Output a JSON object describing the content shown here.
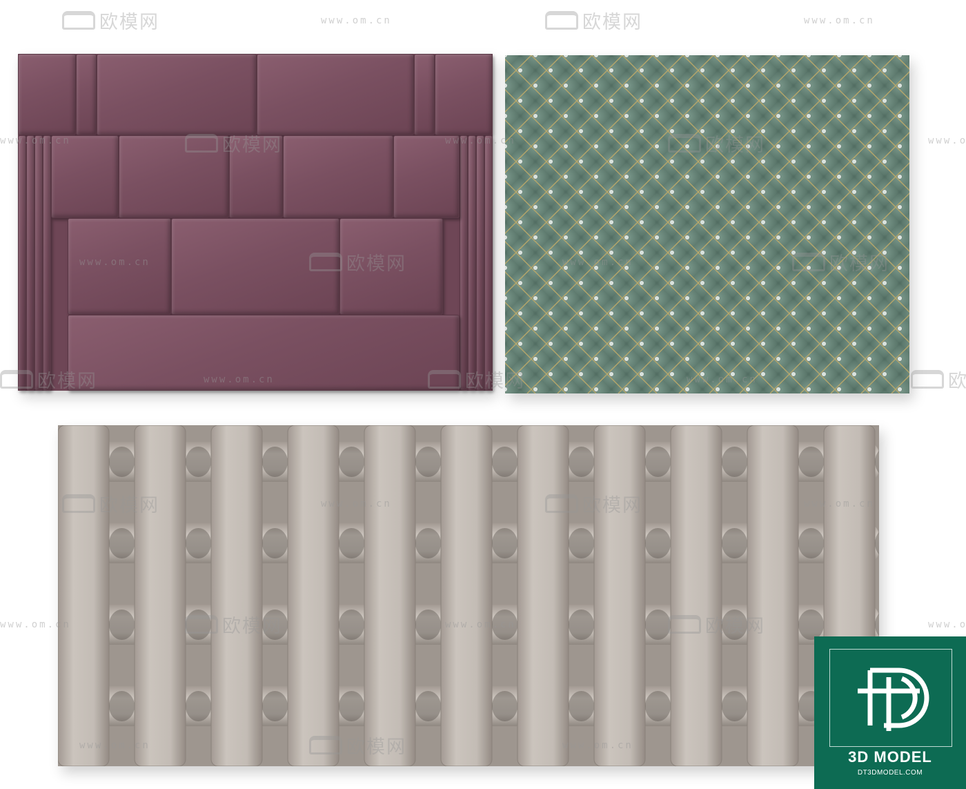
{
  "watermark": {
    "brand": "欧模网",
    "url": "www.om.cn"
  },
  "logo": {
    "title": "3D MODEL",
    "url": "DT3DMODEL.COM"
  },
  "panels": [
    {
      "name": "purple-headboard",
      "color": "#7a5061"
    },
    {
      "name": "green-tufted-panel",
      "color": "#5f7c70"
    },
    {
      "name": "beige-woven-headboard",
      "color": "#b5ada6"
    }
  ]
}
